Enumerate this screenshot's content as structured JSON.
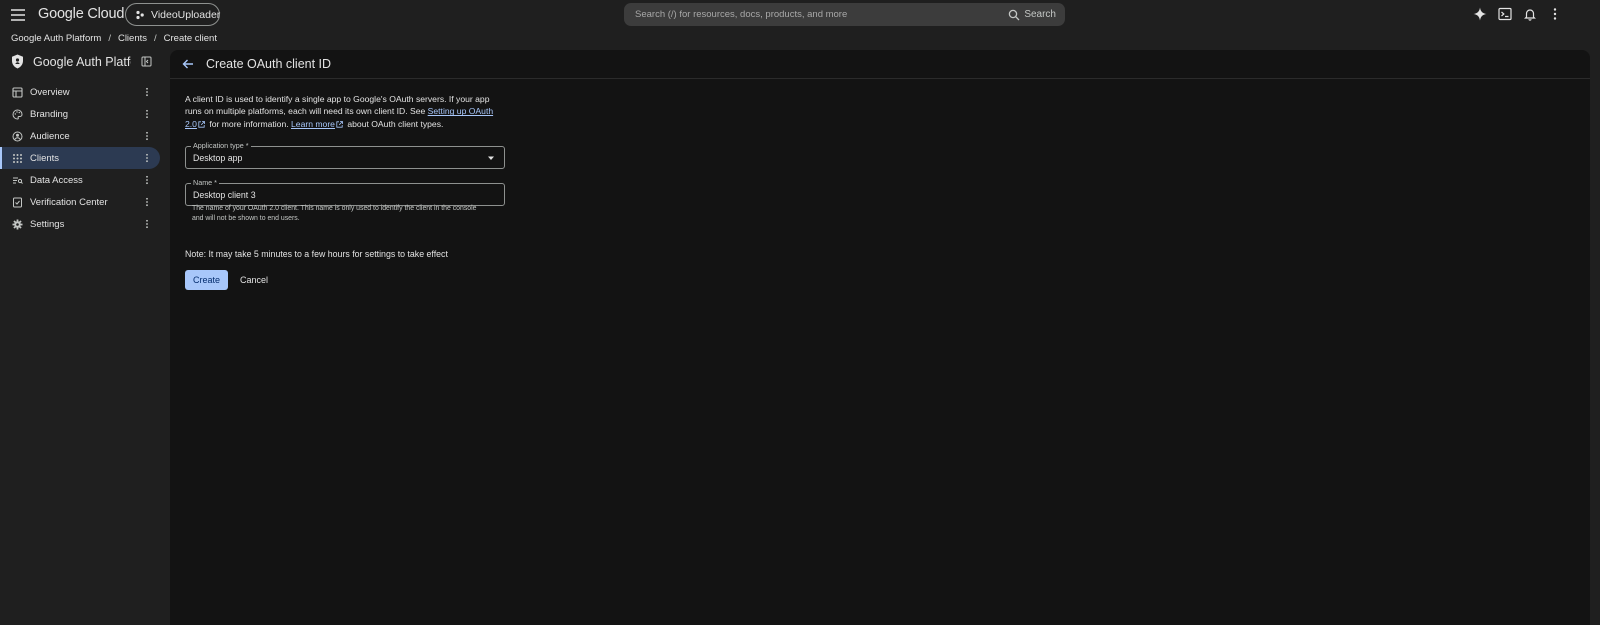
{
  "topbar": {
    "menu_icon": "menu-icon",
    "logo": "Google Cloud",
    "project": "VideoUploader",
    "search_placeholder": "Search (/) for resources, docs, products, and more",
    "search_button": "Search",
    "icons": [
      "gemini-sparkle-icon",
      "cloud-shell-icon",
      "bell-icon",
      "more-vert-icon"
    ]
  },
  "breadcrumb": {
    "items": [
      "Google Auth Platform",
      "Clients",
      "Create client"
    ],
    "separator": "/"
  },
  "sidebar": {
    "title": "Google Auth Platform",
    "items": [
      {
        "label": "Overview",
        "icon": "dashboard-icon"
      },
      {
        "label": "Branding",
        "icon": "palette-icon"
      },
      {
        "label": "Audience",
        "icon": "account-circle-icon"
      },
      {
        "label": "Clients",
        "icon": "apps-grid-icon",
        "active": true
      },
      {
        "label": "Data Access",
        "icon": "data-access-icon"
      },
      {
        "label": "Verification Center",
        "icon": "verified-icon"
      },
      {
        "label": "Settings",
        "icon": "gear-icon"
      }
    ]
  },
  "main": {
    "title": "Create OAuth client ID",
    "intro": {
      "p1": "A client ID is used to identify a single app to Google's OAuth servers. If your app runs on multiple platforms, each will need its own client ID. See ",
      "link1": "Setting up OAuth 2.0",
      "p2": " for more information. ",
      "link2": "Learn more",
      "p3": " about OAuth client types."
    },
    "application_type": {
      "label": "Application type *",
      "value": "Desktop app"
    },
    "name": {
      "label": "Name *",
      "value": "Desktop client 3"
    },
    "name_help": "The name of your OAuth 2.0 client. This name is only used to identify the client in the console and will not be shown to end users.",
    "note": "Note: It may take 5 minutes to a few hours for settings to take effect",
    "create_button": "Create",
    "cancel_button": "Cancel"
  },
  "colors": {
    "background": "#1f1f1f",
    "panel": "#131313",
    "accent": "#a8c7fa",
    "active_nav": "#2c3a52"
  }
}
